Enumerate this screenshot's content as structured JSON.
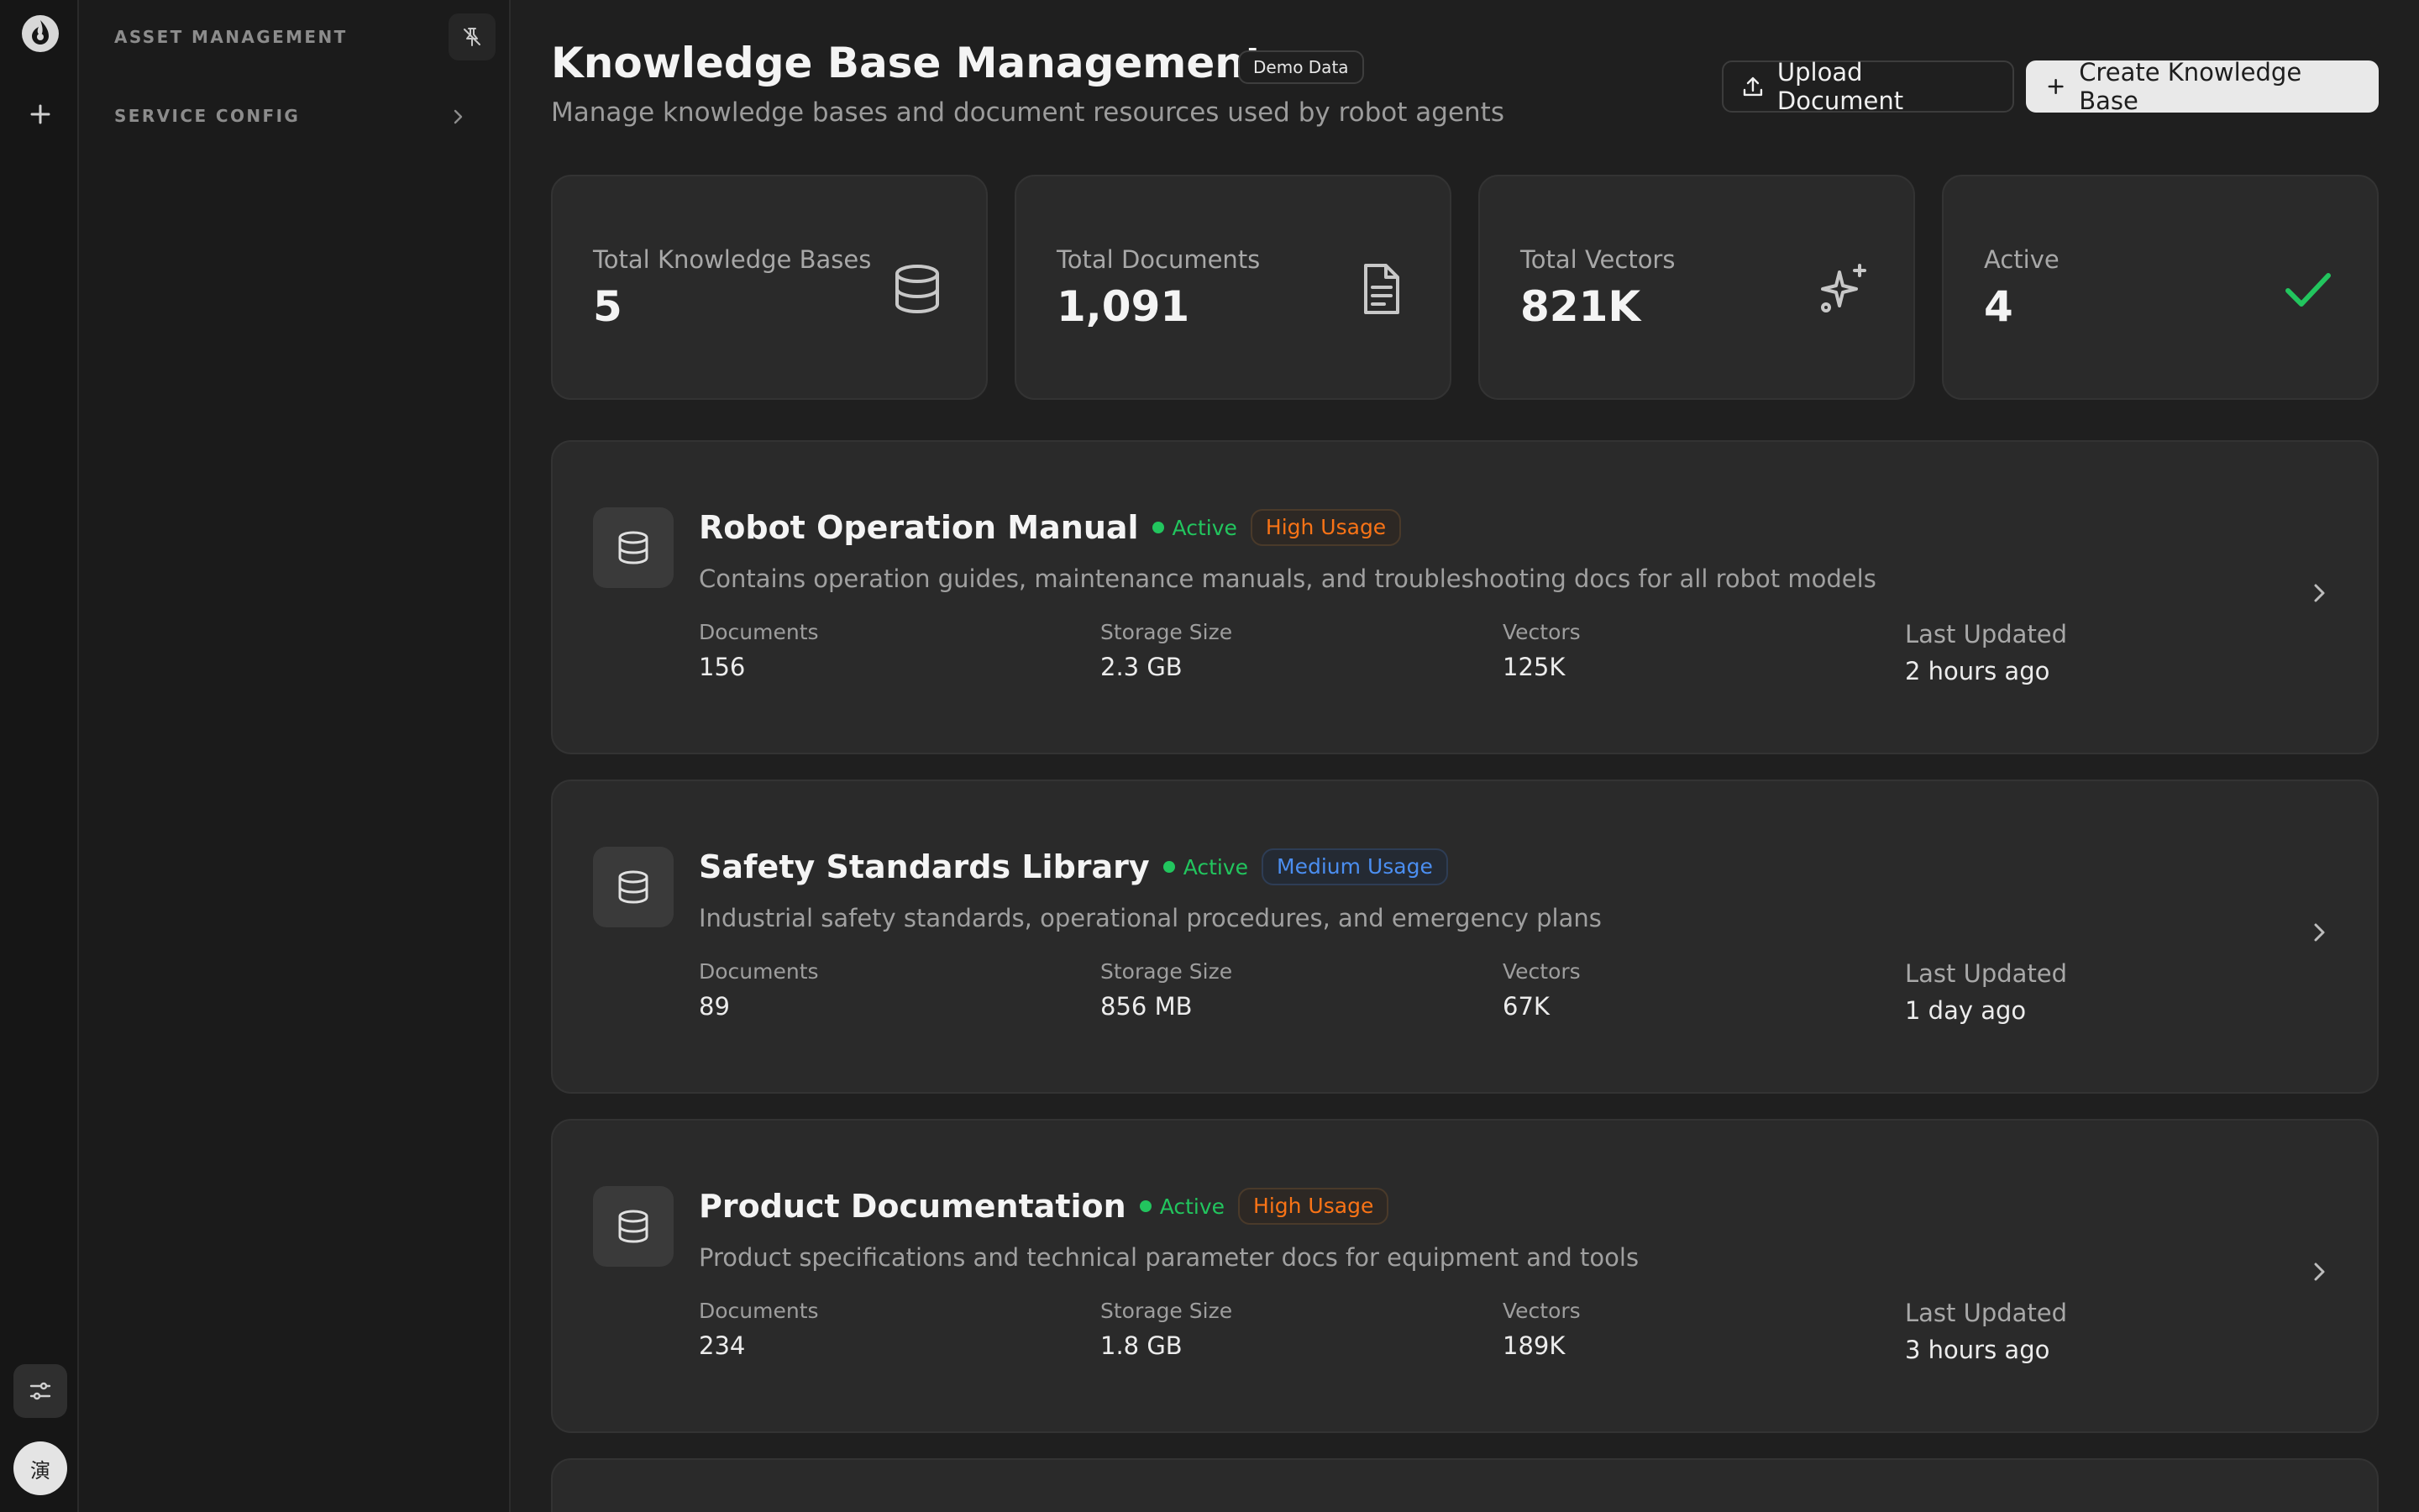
{
  "nav": {
    "sections": [
      "ASSET MANAGEMENT",
      "SERVICE CONFIG"
    ],
    "avatar_text": "演"
  },
  "header": {
    "title": "Knowledge Base Management",
    "badge": "Demo Data",
    "subtitle": "Manage knowledge bases and document resources used by robot agents",
    "upload_label": "Upload Document",
    "create_label": "Create Knowledge Base"
  },
  "stats": [
    {
      "label": "Total Knowledge Bases",
      "value": "5",
      "icon": "database-icon"
    },
    {
      "label": "Total Documents",
      "value": "1,091",
      "icon": "document-icon"
    },
    {
      "label": "Total Vectors",
      "value": "821K",
      "icon": "sparkles-icon"
    },
    {
      "label": "Active",
      "value": "4",
      "icon": "check-icon"
    }
  ],
  "meta_labels": {
    "documents": "Documents",
    "storage": "Storage Size",
    "vectors": "Vectors",
    "updated": "Last Updated"
  },
  "knowledge_bases": [
    {
      "name": "Robot Operation Manual",
      "status": "Active",
      "usage": "High Usage",
      "description": "Contains operation guides, maintenance manuals, and troubleshooting docs for all robot models",
      "documents": "156",
      "storage": "2.3 GB",
      "vectors": "125K",
      "updated": "2 hours ago"
    },
    {
      "name": "Safety Standards Library",
      "status": "Active",
      "usage": "Medium Usage",
      "description": "Industrial safety standards, operational procedures, and emergency plans",
      "documents": "89",
      "storage": "856 MB",
      "vectors": "67K",
      "updated": "1 day ago"
    },
    {
      "name": "Product Documentation",
      "status": "Active",
      "usage": "High Usage",
      "description": "Product specifications and technical parameter docs for equipment and tools",
      "documents": "234",
      "storage": "1.8 GB",
      "vectors": "189K",
      "updated": "3 hours ago"
    }
  ],
  "colors": {
    "background": "#1f1f1f",
    "card": "#2a2a2a",
    "active": "#22c55e",
    "high_usage": "#f97316",
    "medium_usage": "#4b8ef0"
  }
}
